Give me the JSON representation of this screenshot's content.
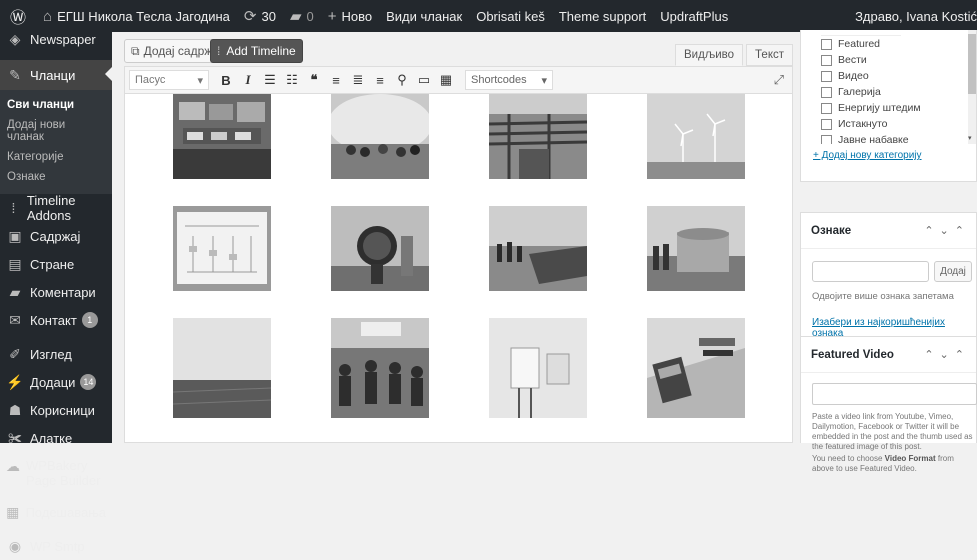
{
  "adminbar": {
    "site_name": "ЕГШ Никола Тесла Јагодина",
    "updates_count": "30",
    "comments_count": "0",
    "new_label": "Ново",
    "view_post": "Види чланак",
    "obrisati": "Obrisati keš",
    "theme_support": "Theme support",
    "updraft": "UpdraftPlus",
    "greeting": "Здраво, Ivana Kostić"
  },
  "menu": {
    "newspaper": "Newspaper",
    "posts": "Чланци",
    "submenu": [
      "Сви чланци",
      "Додај нови чланак",
      "Категорије",
      "Ознаке"
    ],
    "timeline": "Timeline Addons",
    "content": "Садржај",
    "pages": "Стране",
    "comments": "Коментари",
    "contact": "Контакт",
    "contact_badge": "1",
    "appearance": "Изглед",
    "plugins": "Додаци",
    "plugins_badge": "14",
    "users": "Корисници",
    "tools": "Алатке",
    "wpbakery": "WPBakery Page Builder",
    "settings": "Подешавања",
    "wpsmtp": "WP Smtp"
  },
  "editor": {
    "add_content": "Додај садржај",
    "add_timeline": "Add Timeline",
    "tab_visual": "Видљиво",
    "tab_text": "Текст",
    "format": "Пасус",
    "shortcodes": "Shortcodes"
  },
  "sidebar": {
    "categories": [
      "Featured",
      "Вести",
      "Видео",
      "Галерија",
      "Енергију штедим",
      "Истакнуто",
      "Јавне набавке"
    ],
    "add_category": "+ Додај нову категорију",
    "tags_title": "Ознаке",
    "tags_add": "Додај",
    "tags_help": "Одвојите више ознака запетама",
    "tags_choose": "Изабери из најкоришћенијих ознака",
    "video_title": "Featured Video",
    "video_help1": "Paste a video link from Youtube, Vimeo, Dailymotion, Facebook or Twitter it will be embedded in the post and the thumb used as the featured image of this post.",
    "video_help2_a": "You need to choose ",
    "video_help2_b": "Video Format",
    "video_help2_c": " from above to use Featured Video."
  },
  "colors": {
    "adminbar_bg": "#23282d",
    "link": "#0073aa"
  }
}
